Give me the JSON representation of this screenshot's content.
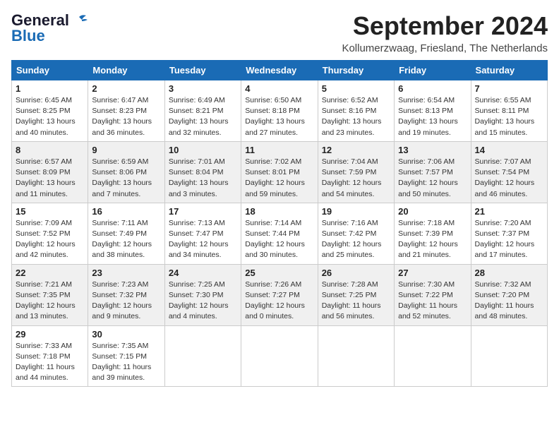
{
  "header": {
    "logo_line1": "General",
    "logo_line2": "Blue",
    "month": "September 2024",
    "location": "Kollumerzwaag, Friesland, The Netherlands"
  },
  "weekdays": [
    "Sunday",
    "Monday",
    "Tuesday",
    "Wednesday",
    "Thursday",
    "Friday",
    "Saturday"
  ],
  "weeks": [
    [
      {
        "day": "1",
        "sunrise": "6:45 AM",
        "sunset": "8:25 PM",
        "daylight": "13 hours and 40 minutes."
      },
      {
        "day": "2",
        "sunrise": "6:47 AM",
        "sunset": "8:23 PM",
        "daylight": "13 hours and 36 minutes."
      },
      {
        "day": "3",
        "sunrise": "6:49 AM",
        "sunset": "8:21 PM",
        "daylight": "13 hours and 32 minutes."
      },
      {
        "day": "4",
        "sunrise": "6:50 AM",
        "sunset": "8:18 PM",
        "daylight": "13 hours and 27 minutes."
      },
      {
        "day": "5",
        "sunrise": "6:52 AM",
        "sunset": "8:16 PM",
        "daylight": "13 hours and 23 minutes."
      },
      {
        "day": "6",
        "sunrise": "6:54 AM",
        "sunset": "8:13 PM",
        "daylight": "13 hours and 19 minutes."
      },
      {
        "day": "7",
        "sunrise": "6:55 AM",
        "sunset": "8:11 PM",
        "daylight": "13 hours and 15 minutes."
      }
    ],
    [
      {
        "day": "8",
        "sunrise": "6:57 AM",
        "sunset": "8:09 PM",
        "daylight": "13 hours and 11 minutes."
      },
      {
        "day": "9",
        "sunrise": "6:59 AM",
        "sunset": "8:06 PM",
        "daylight": "13 hours and 7 minutes."
      },
      {
        "day": "10",
        "sunrise": "7:01 AM",
        "sunset": "8:04 PM",
        "daylight": "13 hours and 3 minutes."
      },
      {
        "day": "11",
        "sunrise": "7:02 AM",
        "sunset": "8:01 PM",
        "daylight": "12 hours and 59 minutes."
      },
      {
        "day": "12",
        "sunrise": "7:04 AM",
        "sunset": "7:59 PM",
        "daylight": "12 hours and 54 minutes."
      },
      {
        "day": "13",
        "sunrise": "7:06 AM",
        "sunset": "7:57 PM",
        "daylight": "12 hours and 50 minutes."
      },
      {
        "day": "14",
        "sunrise": "7:07 AM",
        "sunset": "7:54 PM",
        "daylight": "12 hours and 46 minutes."
      }
    ],
    [
      {
        "day": "15",
        "sunrise": "7:09 AM",
        "sunset": "7:52 PM",
        "daylight": "12 hours and 42 minutes."
      },
      {
        "day": "16",
        "sunrise": "7:11 AM",
        "sunset": "7:49 PM",
        "daylight": "12 hours and 38 minutes."
      },
      {
        "day": "17",
        "sunrise": "7:13 AM",
        "sunset": "7:47 PM",
        "daylight": "12 hours and 34 minutes."
      },
      {
        "day": "18",
        "sunrise": "7:14 AM",
        "sunset": "7:44 PM",
        "daylight": "12 hours and 30 minutes."
      },
      {
        "day": "19",
        "sunrise": "7:16 AM",
        "sunset": "7:42 PM",
        "daylight": "12 hours and 25 minutes."
      },
      {
        "day": "20",
        "sunrise": "7:18 AM",
        "sunset": "7:39 PM",
        "daylight": "12 hours and 21 minutes."
      },
      {
        "day": "21",
        "sunrise": "7:20 AM",
        "sunset": "7:37 PM",
        "daylight": "12 hours and 17 minutes."
      }
    ],
    [
      {
        "day": "22",
        "sunrise": "7:21 AM",
        "sunset": "7:35 PM",
        "daylight": "12 hours and 13 minutes."
      },
      {
        "day": "23",
        "sunrise": "7:23 AM",
        "sunset": "7:32 PM",
        "daylight": "12 hours and 9 minutes."
      },
      {
        "day": "24",
        "sunrise": "7:25 AM",
        "sunset": "7:30 PM",
        "daylight": "12 hours and 4 minutes."
      },
      {
        "day": "25",
        "sunrise": "7:26 AM",
        "sunset": "7:27 PM",
        "daylight": "12 hours and 0 minutes."
      },
      {
        "day": "26",
        "sunrise": "7:28 AM",
        "sunset": "7:25 PM",
        "daylight": "11 hours and 56 minutes."
      },
      {
        "day": "27",
        "sunrise": "7:30 AM",
        "sunset": "7:22 PM",
        "daylight": "11 hours and 52 minutes."
      },
      {
        "day": "28",
        "sunrise": "7:32 AM",
        "sunset": "7:20 PM",
        "daylight": "11 hours and 48 minutes."
      }
    ],
    [
      {
        "day": "29",
        "sunrise": "7:33 AM",
        "sunset": "7:18 PM",
        "daylight": "11 hours and 44 minutes."
      },
      {
        "day": "30",
        "sunrise": "7:35 AM",
        "sunset": "7:15 PM",
        "daylight": "11 hours and 39 minutes."
      },
      null,
      null,
      null,
      null,
      null
    ]
  ]
}
